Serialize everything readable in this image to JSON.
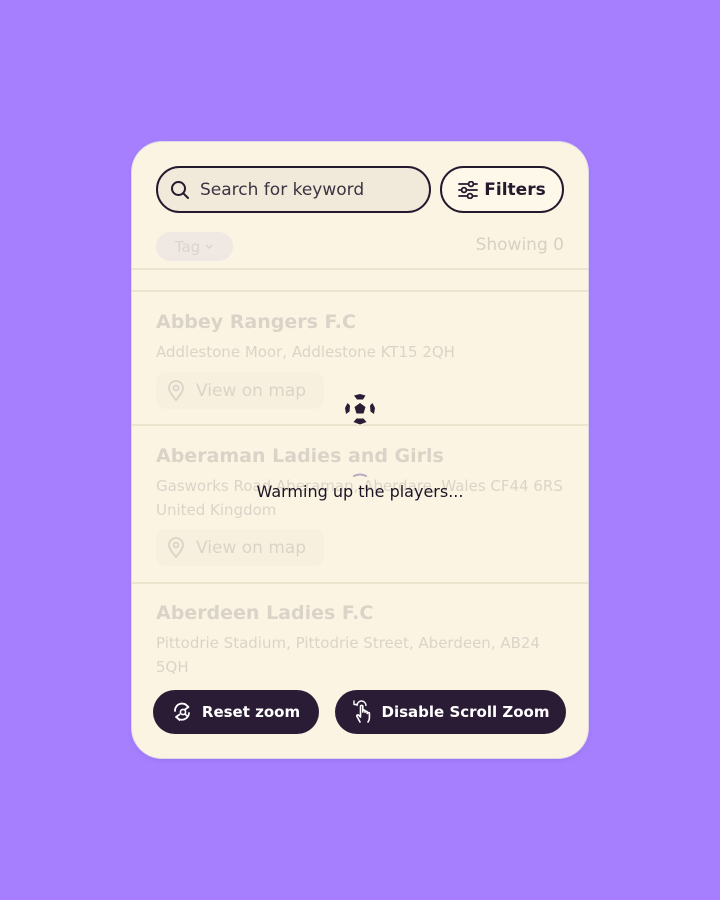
{
  "search": {
    "placeholder": "Search for keyword",
    "icon": "search-icon"
  },
  "filters": {
    "label": "Filters",
    "icon": "sliders-icon"
  },
  "tag_filter": {
    "label": "Tag",
    "icon": "chevron-down-icon"
  },
  "results": {
    "label": "Showing",
    "count": "0"
  },
  "clubs": [
    {
      "name": "Abbey Rangers F.C",
      "address": "Addlestone Moor, Addlestone KT15 2QH",
      "map_label": "View on map"
    },
    {
      "name": "Aberaman Ladies and Girls",
      "address": "Gasworks Road Aberaman, Aberdare, Wales CF44 6RS United Kingdom",
      "map_label": "View on map"
    },
    {
      "name": "Aberdeen Ladies F.C",
      "address": "Pittodrie Stadium, Pittodrie Street, Aberdeen, AB24 5QH"
    }
  ],
  "loading": {
    "text": "Warming up the players...",
    "icon": "soccer-ball-icon"
  },
  "map_controls": {
    "reset_zoom": "Reset zoom",
    "disable_scroll_zoom": "Disable Scroll Zoom"
  },
  "colors": {
    "background": "#a67ffe",
    "card": "#fbf4e2",
    "dark": "#2b1c35"
  }
}
